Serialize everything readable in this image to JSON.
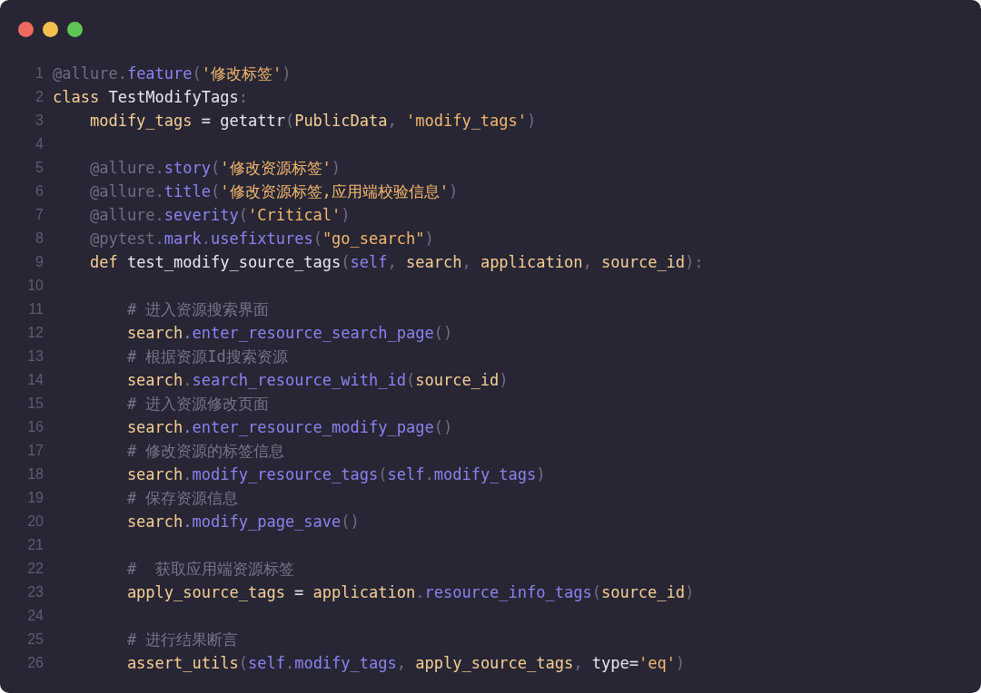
{
  "window": {
    "controls": [
      {
        "color": "#ed6a5e"
      },
      {
        "color": "#f4bf4f"
      },
      {
        "color": "#61c554"
      }
    ]
  },
  "code": {
    "lines": [
      {
        "number": "1",
        "tokens": [
          {
            "text": "@allure.",
            "kind": "punct"
          },
          {
            "text": "feature",
            "kind": "method"
          },
          {
            "text": "(",
            "kind": "punct"
          },
          {
            "text": "'修改标签'",
            "kind": "str"
          },
          {
            "text": ")",
            "kind": "punct"
          }
        ]
      },
      {
        "number": "2",
        "tokens": [
          {
            "text": "class ",
            "kind": "kw"
          },
          {
            "text": "TestModifyTags",
            "kind": "plain"
          },
          {
            "text": ":",
            "kind": "punct"
          }
        ]
      },
      {
        "number": "3",
        "tokens": [
          {
            "text": "    modify_tags ",
            "kind": "kw"
          },
          {
            "text": "= getattr",
            "kind": "plain"
          },
          {
            "text": "(",
            "kind": "punct"
          },
          {
            "text": "PublicData",
            "kind": "kw"
          },
          {
            "text": ", ",
            "kind": "punct"
          },
          {
            "text": "'modify_tags'",
            "kind": "str"
          },
          {
            "text": ")",
            "kind": "punct"
          }
        ]
      },
      {
        "number": "4"
      },
      {
        "number": "5",
        "tokens": [
          {
            "text": "    @allure.",
            "kind": "punct"
          },
          {
            "text": "story",
            "kind": "method"
          },
          {
            "text": "(",
            "kind": "punct"
          },
          {
            "text": "'修改资源标签'",
            "kind": "str"
          },
          {
            "text": ")",
            "kind": "punct"
          }
        ]
      },
      {
        "number": "6",
        "tokens": [
          {
            "text": "    @allure.",
            "kind": "punct"
          },
          {
            "text": "title",
            "kind": "method"
          },
          {
            "text": "(",
            "kind": "punct"
          },
          {
            "text": "'修改资源标签,应用端校验信息'",
            "kind": "str"
          },
          {
            "text": ")",
            "kind": "punct"
          }
        ]
      },
      {
        "number": "7",
        "tokens": [
          {
            "text": "    @allure.",
            "kind": "punct"
          },
          {
            "text": "severity",
            "kind": "method"
          },
          {
            "text": "(",
            "kind": "punct"
          },
          {
            "text": "'Critical'",
            "kind": "str"
          },
          {
            "text": ")",
            "kind": "punct"
          }
        ]
      },
      {
        "number": "8",
        "tokens": [
          {
            "text": "    @pytest.",
            "kind": "punct"
          },
          {
            "text": "mark",
            "kind": "method"
          },
          {
            "text": ".",
            "kind": "punct"
          },
          {
            "text": "usefixtures",
            "kind": "method"
          },
          {
            "text": "(",
            "kind": "punct"
          },
          {
            "text": "\"go_search\"",
            "kind": "str"
          },
          {
            "text": ")",
            "kind": "punct"
          }
        ]
      },
      {
        "number": "9",
        "tokens": [
          {
            "text": "    def ",
            "kind": "kw"
          },
          {
            "text": "test_modify_source_tags",
            "kind": "plain"
          },
          {
            "text": "(",
            "kind": "punct"
          },
          {
            "text": "self",
            "kind": "method"
          },
          {
            "text": ", ",
            "kind": "punct"
          },
          {
            "text": "search",
            "kind": "kw"
          },
          {
            "text": ", ",
            "kind": "punct"
          },
          {
            "text": "application",
            "kind": "kw"
          },
          {
            "text": ", ",
            "kind": "punct"
          },
          {
            "text": "source_id",
            "kind": "kw"
          },
          {
            "text": "):",
            "kind": "punct"
          }
        ]
      },
      {
        "number": "10"
      },
      {
        "number": "11",
        "tokens": [
          {
            "text": "        # 进入资源搜索界面",
            "kind": "comment"
          }
        ]
      },
      {
        "number": "12",
        "tokens": [
          {
            "text": "        search",
            "kind": "kw"
          },
          {
            "text": ".enter_resource_search_page",
            "kind": "method"
          },
          {
            "text": "()",
            "kind": "punct"
          }
        ]
      },
      {
        "number": "13",
        "tokens": [
          {
            "text": "        # 根据资源Id搜索资源",
            "kind": "comment"
          }
        ]
      },
      {
        "number": "14",
        "tokens": [
          {
            "text": "        search",
            "kind": "kw"
          },
          {
            "text": ".",
            "kind": "punct"
          },
          {
            "text": "search_resource_with_id",
            "kind": "method"
          },
          {
            "text": "(",
            "kind": "punct"
          },
          {
            "text": "source_id",
            "kind": "kw"
          },
          {
            "text": ")",
            "kind": "punct"
          }
        ]
      },
      {
        "number": "15",
        "tokens": [
          {
            "text": "        # 进入资源修改页面",
            "kind": "comment"
          }
        ]
      },
      {
        "number": "16",
        "tokens": [
          {
            "text": "        search",
            "kind": "kw"
          },
          {
            "text": ".enter_resource_modify_page",
            "kind": "method"
          },
          {
            "text": "()",
            "kind": "punct"
          }
        ]
      },
      {
        "number": "17",
        "tokens": [
          {
            "text": "        # 修改资源的标签信息",
            "kind": "comment"
          }
        ]
      },
      {
        "number": "18",
        "tokens": [
          {
            "text": "        search",
            "kind": "kw"
          },
          {
            "text": ".",
            "kind": "punct"
          },
          {
            "text": "modify_resource_tags",
            "kind": "method"
          },
          {
            "text": "(",
            "kind": "punct"
          },
          {
            "text": "self",
            "kind": "method"
          },
          {
            "text": ".",
            "kind": "punct"
          },
          {
            "text": "modify_tags",
            "kind": "method"
          },
          {
            "text": ")",
            "kind": "punct"
          }
        ]
      },
      {
        "number": "19",
        "tokens": [
          {
            "text": "        # 保存资源信息",
            "kind": "comment"
          }
        ]
      },
      {
        "number": "20",
        "tokens": [
          {
            "text": "        search",
            "kind": "kw"
          },
          {
            "text": ".modify_page_save",
            "kind": "method"
          },
          {
            "text": "()",
            "kind": "punct"
          }
        ]
      },
      {
        "number": "21"
      },
      {
        "number": "22",
        "tokens": [
          {
            "text": "        #  获取应用端资源标签",
            "kind": "comment"
          }
        ]
      },
      {
        "number": "23",
        "tokens": [
          {
            "text": "        apply_source_tags ",
            "kind": "kw"
          },
          {
            "text": "= ",
            "kind": "plain"
          },
          {
            "text": "application",
            "kind": "kw"
          },
          {
            "text": ".",
            "kind": "punct"
          },
          {
            "text": "resource_info_tags",
            "kind": "method"
          },
          {
            "text": "(",
            "kind": "punct"
          },
          {
            "text": "source_id",
            "kind": "kw"
          },
          {
            "text": ")",
            "kind": "punct"
          }
        ]
      },
      {
        "number": "24"
      },
      {
        "number": "25",
        "tokens": [
          {
            "text": "        # 进行结果断言",
            "kind": "comment"
          }
        ]
      },
      {
        "number": "26",
        "tokens": [
          {
            "text": "        assert_utils",
            "kind": "kw"
          },
          {
            "text": "(",
            "kind": "punct"
          },
          {
            "text": "self",
            "kind": "method"
          },
          {
            "text": ".",
            "kind": "punct"
          },
          {
            "text": "modify_tags",
            "kind": "method"
          },
          {
            "text": ", ",
            "kind": "punct"
          },
          {
            "text": "apply_source_tags",
            "kind": "kw"
          },
          {
            "text": ", ",
            "kind": "punct"
          },
          {
            "text": "type=",
            "kind": "plain"
          },
          {
            "text": "'eq'",
            "kind": "str"
          },
          {
            "text": ")",
            "kind": "punct"
          }
        ]
      }
    ]
  }
}
